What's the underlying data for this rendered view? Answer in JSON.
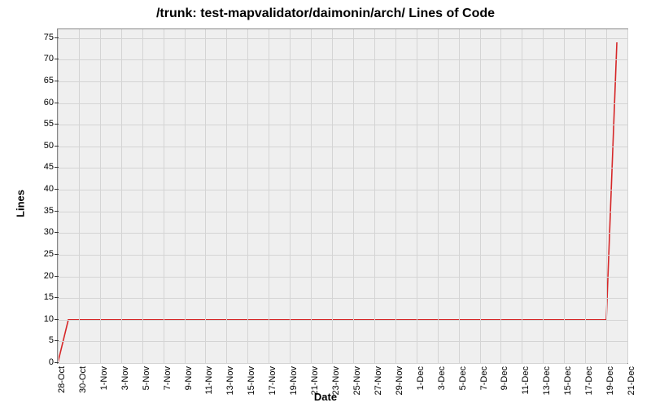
{
  "chart_data": {
    "type": "line",
    "title": "/trunk: test-mapvalidator/daimonin/arch/ Lines of Code",
    "xlabel": "Date",
    "ylabel": "Lines",
    "ylim": [
      0,
      77
    ],
    "y_ticks": [
      0,
      5,
      10,
      15,
      20,
      25,
      30,
      35,
      40,
      45,
      50,
      55,
      60,
      65,
      70,
      75
    ],
    "x_categories": [
      "28-Oct",
      "30-Oct",
      "1-Nov",
      "3-Nov",
      "5-Nov",
      "7-Nov",
      "9-Nov",
      "11-Nov",
      "13-Nov",
      "15-Nov",
      "17-Nov",
      "19-Nov",
      "21-Nov",
      "23-Nov",
      "25-Nov",
      "27-Nov",
      "29-Nov",
      "1-Dec",
      "3-Dec",
      "5-Dec",
      "7-Dec",
      "9-Dec",
      "11-Dec",
      "13-Dec",
      "15-Dec",
      "17-Dec",
      "19-Dec",
      "21-Dec"
    ],
    "xlim_days": [
      0,
      54
    ],
    "series": [
      {
        "name": "lines-of-code",
        "color": "#d62728",
        "points": [
          {
            "day": 0,
            "value": 0
          },
          {
            "day": 1,
            "value": 10
          },
          {
            "day": 52,
            "value": 10
          },
          {
            "day": 53,
            "value": 74
          }
        ]
      }
    ]
  }
}
